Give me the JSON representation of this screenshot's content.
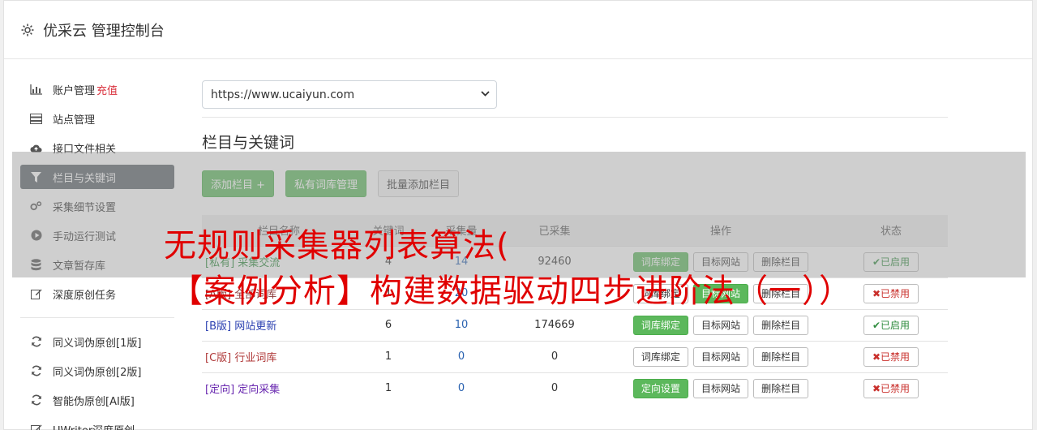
{
  "app": {
    "title": "优采云 管理控制台",
    "icon": "gear-icon"
  },
  "sidebar": {
    "items": [
      {
        "label": "账户管理",
        "badge": "充值",
        "icon": "bar-chart-icon",
        "active": false
      },
      {
        "label": "站点管理",
        "icon": "server-icon",
        "active": false
      },
      {
        "label": "接口文件相关",
        "icon": "cloud-upload-icon",
        "active": false
      },
      {
        "label": "栏目与关键词",
        "icon": "filter-icon",
        "active": true
      },
      {
        "label": "采集细节设置",
        "icon": "cogs-icon",
        "active": false
      },
      {
        "label": "手动运行测试",
        "icon": "play-circle-icon",
        "active": false
      },
      {
        "label": "文章暂存库",
        "icon": "database-icon",
        "active": false
      },
      {
        "label": "深度原创任务",
        "icon": "edit-icon",
        "active": false
      }
    ],
    "items2": [
      {
        "label": "同义词伪原创[1版]",
        "icon": "refresh-icon"
      },
      {
        "label": "同义词伪原创[2版]",
        "icon": "refresh-icon"
      },
      {
        "label": "智能伪原创[AI版]",
        "icon": "refresh-icon"
      },
      {
        "label": "UWriter深度原创",
        "icon": "edit-icon"
      }
    ]
  },
  "site_select": {
    "value": "https://www.ucaiyun.com"
  },
  "section": {
    "title": "栏目与关键词"
  },
  "actions": {
    "add_column": "添加栏目 +",
    "private_lib": "私有词库管理",
    "batch_add": "批量添加栏目"
  },
  "table": {
    "headers": [
      "栏目名称",
      "关键词",
      "采集量",
      "已采集",
      "操作",
      "状态"
    ],
    "rows": [
      {
        "tag": "[私有]",
        "name": "采集交流",
        "kw": "4",
        "count": "14",
        "collected": "92460",
        "op1": "词库绑定",
        "op2": "目标网站",
        "op3": "删除栏目",
        "status": "✔已启用",
        "on": true
      },
      {
        "tag": "[A版]",
        "name": "全部词库",
        "kw": "1",
        "count": "20",
        "collected": "",
        "op1": "词库绑定",
        "op2": "目标网站",
        "op3": "删除栏目",
        "status": "✖已禁用",
        "on": false
      },
      {
        "tag": "[B版]",
        "name": "网站更新",
        "kw": "6",
        "count": "10",
        "collected": "174669",
        "op1": "词库绑定",
        "op2": "目标网站",
        "op3": "删除栏目",
        "status": "✔已启用",
        "on": true
      },
      {
        "tag": "[C版]",
        "name": "行业词库",
        "kw": "1",
        "count": "0",
        "collected": "0",
        "op1": "词库绑定",
        "op2": "目标网站",
        "op3": "删除栏目",
        "status": "✖已禁用",
        "on": false
      },
      {
        "tag": "[定向]",
        "name": "定向采集",
        "kw": "1",
        "count": "0",
        "collected": "0",
        "op1": "定向设置",
        "op2": "目标网站",
        "op3": "删除栏目",
        "status": "✖已禁用",
        "on": false
      }
    ]
  },
  "overlay": {
    "line1": "无规则采集器列表算法(",
    "line2": "【案例分析】构建数据驱动四步进阶法（一））"
  }
}
